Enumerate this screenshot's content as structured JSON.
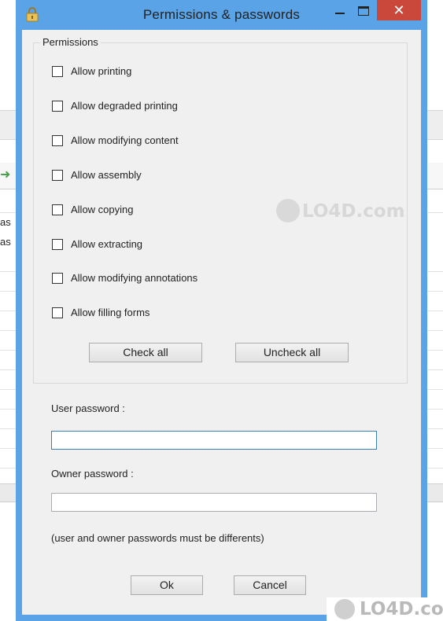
{
  "background": {
    "fragment_lines": [
      "as",
      "as"
    ]
  },
  "window": {
    "title": "Permissions & passwords",
    "icons": {
      "app": "lock-icon",
      "minimize": "minimize-icon",
      "maximize": "maximize-icon",
      "close": "close-icon"
    },
    "close_glyph": "✕"
  },
  "permissions": {
    "group_title": "Permissions",
    "items": [
      {
        "label": "Allow printing",
        "checked": false
      },
      {
        "label": "Allow degraded printing",
        "checked": false
      },
      {
        "label": "Allow modifying content",
        "checked": false
      },
      {
        "label": "Allow assembly",
        "checked": false
      },
      {
        "label": "Allow copying",
        "checked": false
      },
      {
        "label": "Allow extracting",
        "checked": false
      },
      {
        "label": "Allow modifying annotations",
        "checked": false
      },
      {
        "label": "Allow filling forms",
        "checked": false
      }
    ],
    "check_all_label": "Check all",
    "uncheck_all_label": "Uncheck all"
  },
  "passwords": {
    "user_label": "User password :",
    "user_value": "",
    "owner_label": "Owner password :",
    "owner_value": "",
    "note": "(user and owner passwords must be differents)"
  },
  "actions": {
    "ok_label": "Ok",
    "cancel_label": "Cancel"
  },
  "watermark": {
    "text": "LO4D.com"
  },
  "colors": {
    "title_bar": "#5aa3e6",
    "close_button": "#c9483b",
    "dialog_background": "#f0f0f0",
    "focused_field_border": "#3c7fb1"
  }
}
